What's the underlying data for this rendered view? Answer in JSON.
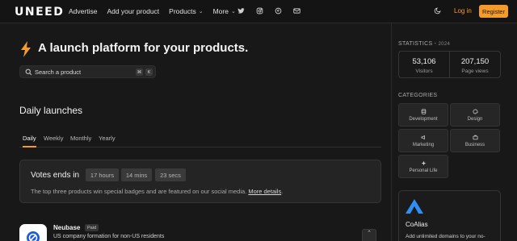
{
  "header": {
    "logo": "UNEED",
    "nav": {
      "advertise": "Advertise",
      "add_product": "Add your product",
      "products": "Products",
      "more": "More"
    },
    "social_icons": [
      "twitter-icon",
      "instagram-icon",
      "threads-icon",
      "mail-icon"
    ],
    "login": "Log in",
    "register": "Register"
  },
  "hero": {
    "title": "A launch platform for your products.",
    "search_placeholder": "Search a product",
    "shortcut": [
      "⌘",
      "K"
    ]
  },
  "main": {
    "section_title": "Daily launches",
    "tabs": [
      "Daily",
      "Weekly",
      "Monthly",
      "Yearly"
    ],
    "active_tab": "Daily",
    "votes": {
      "title": "Votes ends in",
      "hours": "17 hours",
      "mins": "14 mins",
      "secs": "23 secs",
      "desc": "The top three products win special badges and are featured on our social media.",
      "link": "More details"
    },
    "product": {
      "name": "Neubase",
      "badge": "Paid",
      "desc": "US company formation for non-US residents"
    }
  },
  "sidebar": {
    "statistics_label": "STATISTICS",
    "statistics_year": "2024",
    "visitors_value": "53,106",
    "visitors_label": "Visitors",
    "pageviews_value": "207,150",
    "pageviews_label": "Page views",
    "categories_label": "CATEGORIES",
    "categories": [
      "Development",
      "Design",
      "Marketing",
      "Business",
      "Personal Life"
    ],
    "ad": {
      "name": "CoAlias",
      "desc": "Add unlimited domains to your no-"
    }
  },
  "colors": {
    "accent": "#f59b2a",
    "background": "#181818",
    "card": "#242424"
  }
}
